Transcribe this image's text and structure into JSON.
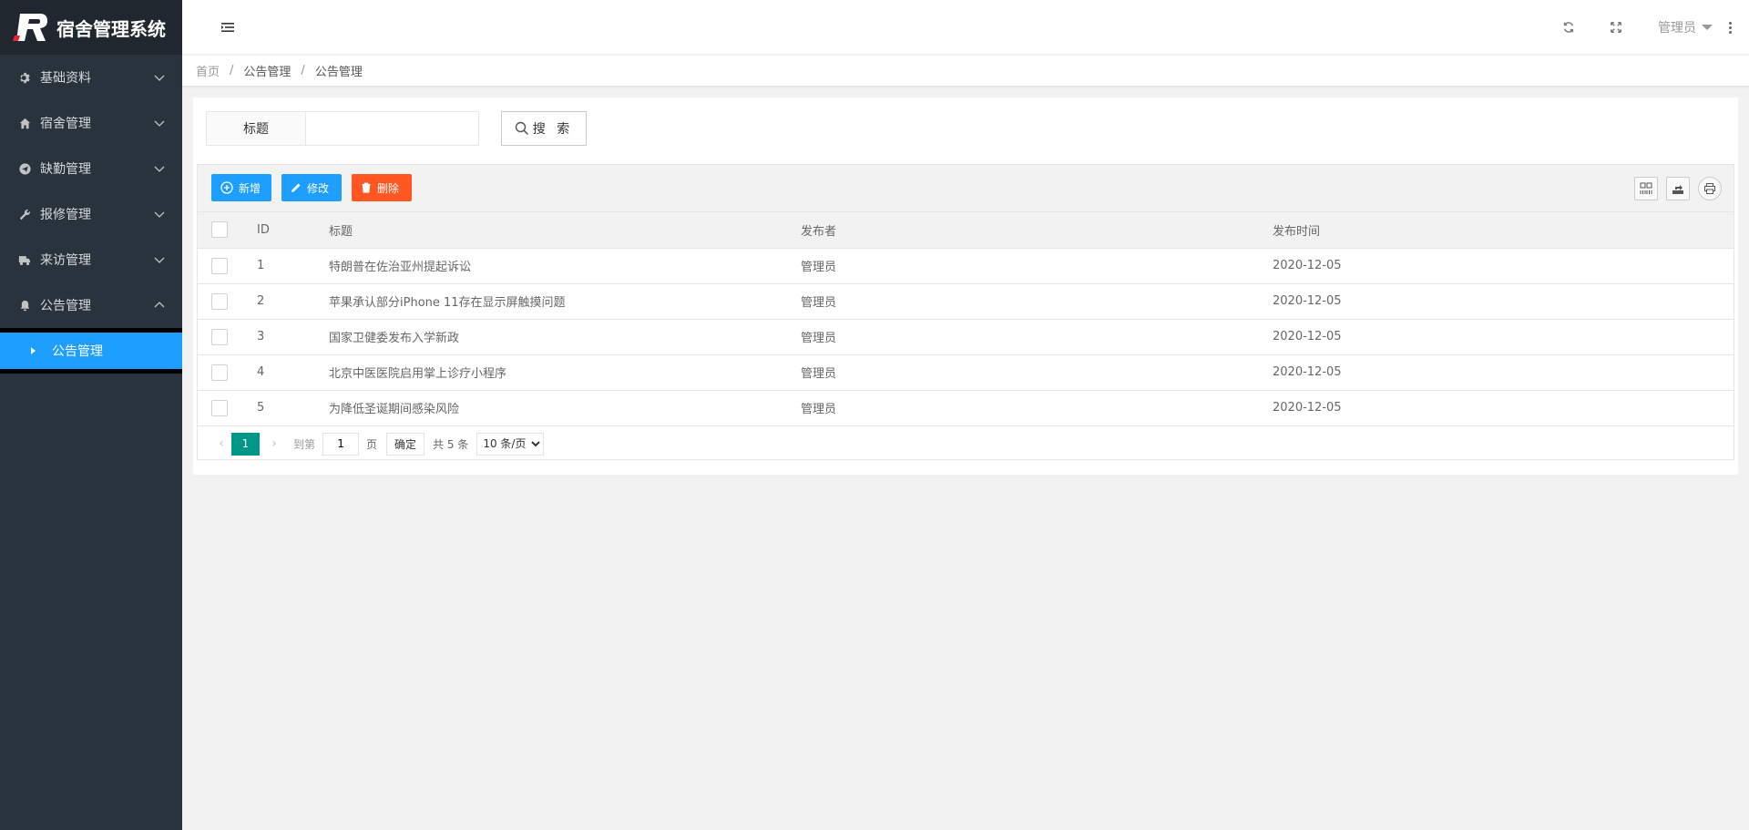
{
  "app": {
    "title": "宿舍管理系统"
  },
  "sidebar": {
    "items": [
      {
        "label": "基础资料",
        "icon": "gear-icon"
      },
      {
        "label": "宿舍管理",
        "icon": "home-icon"
      },
      {
        "label": "缺勤管理",
        "icon": "send-icon"
      },
      {
        "label": "报修管理",
        "icon": "wrench-icon"
      },
      {
        "label": "来访管理",
        "icon": "truck-icon"
      },
      {
        "label": "公告管理",
        "icon": "bell-icon"
      }
    ],
    "active_sub": "公告管理"
  },
  "header": {
    "user": "管理员"
  },
  "breadcrumb": {
    "home": "首页",
    "level1": "公告管理",
    "level2": "公告管理"
  },
  "search": {
    "label": "标题",
    "value": "",
    "button": "搜 索"
  },
  "toolbar": {
    "add": "新增",
    "edit": "修改",
    "delete": "删除"
  },
  "table": {
    "columns": [
      "ID",
      "标题",
      "发布者",
      "发布时间"
    ],
    "rows": [
      {
        "id": "1",
        "title": "特朗普在佐治亚州提起诉讼",
        "publisher": "管理员",
        "time": "2020-12-05"
      },
      {
        "id": "2",
        "title": "苹果承认部分iPhone 11存在显示屏触摸问题",
        "publisher": "管理员",
        "time": "2020-12-05"
      },
      {
        "id": "3",
        "title": "国家卫健委发布入学新政",
        "publisher": "管理员",
        "time": "2020-12-05"
      },
      {
        "id": "4",
        "title": "北京中医医院启用掌上诊疗小程序",
        "publisher": "管理员",
        "time": "2020-12-05"
      },
      {
        "id": "5",
        "title": "为降低圣诞期间感染风险",
        "publisher": "管理员",
        "time": "2020-12-05"
      }
    ]
  },
  "pager": {
    "current": "1",
    "goto_label": "到第",
    "goto_value": "1",
    "page_label": "页",
    "ok": "确定",
    "total": "共 5 条",
    "per_page": "10 条/页"
  },
  "colors": {
    "sidebar_bg": "#28333e",
    "logo_bg": "#20272f",
    "accent_blue": "#1e9fff",
    "danger": "#ff5722",
    "pager_active": "#009688"
  }
}
